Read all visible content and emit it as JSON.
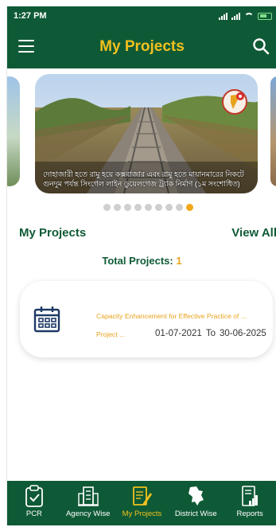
{
  "status_bar": {
    "time": "1:27 PM",
    "icons": [
      "signal-icon",
      "signal-icon",
      "wifi-icon",
      "battery-icon"
    ]
  },
  "app_bar": {
    "title": "My Projects",
    "left_icon": "menu-icon",
    "right_icon": "search-icon"
  },
  "carousel": {
    "caption": "দোহাজারী হতে রামু হয়ে কক্সবাজার এবং রামু হতে মায়ানমারের নিকটে গুনদুম পর্যন্ত সিংগেল লাইন ডুয়েলগেজ ট্র্যাক নির্মাণ (১ম সংশোধিত)",
    "slide_count": 9,
    "active_index": 8
  },
  "section": {
    "title": "My Projects",
    "view_all_label": "View All"
  },
  "total": {
    "label": "Total Projects:",
    "count": "1"
  },
  "project": {
    "name": "Capacity Enhancement for Effective Practice of ...",
    "type": "Project ...",
    "start_date": "01-07-2021",
    "to_label": "To",
    "end_date": "30-06-2025"
  },
  "bottom_nav": {
    "items": [
      {
        "label": "PCR",
        "icon": "clipboard-check-icon",
        "active": false
      },
      {
        "label": "Agency Wise",
        "icon": "building-icon",
        "active": false
      },
      {
        "label": "My Projects",
        "icon": "edit-document-icon",
        "active": true
      },
      {
        "label": "District Wise",
        "icon": "bangladesh-map-icon",
        "active": false
      },
      {
        "label": "Reports",
        "icon": "report-chart-icon",
        "active": false
      }
    ]
  },
  "colors": {
    "primary": "#0f5a36",
    "accent": "#f2c01e",
    "highlight": "#e8a31d"
  }
}
